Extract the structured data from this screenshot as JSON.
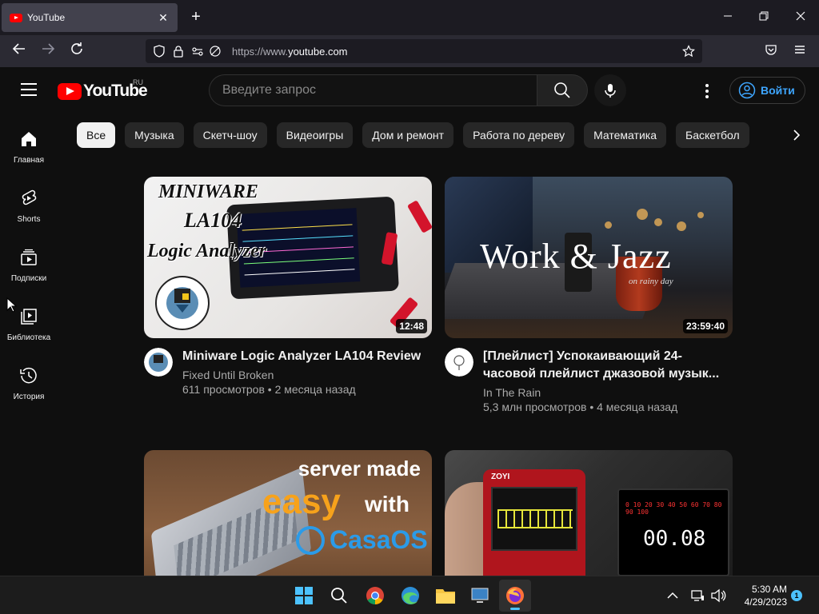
{
  "browser": {
    "tab_title": "YouTube",
    "tab_close": "✕",
    "new_tab": "+",
    "url_prefix": "https://www.",
    "url_domain": "youtube.com"
  },
  "youtube": {
    "logo_text": "YouTube",
    "region": "RU",
    "search_placeholder": "Введите запрос",
    "signin_label": "Войти",
    "sidebar": [
      {
        "label": "Главная",
        "icon": "home-icon"
      },
      {
        "label": "Shorts",
        "icon": "shorts-icon"
      },
      {
        "label": "Подписки",
        "icon": "subscriptions-icon"
      },
      {
        "label": "Библиотека",
        "icon": "library-icon"
      },
      {
        "label": "История",
        "icon": "history-icon"
      }
    ],
    "chips": [
      "Все",
      "Музыка",
      "Скетч-шоу",
      "Видеоигры",
      "Дом и ремонт",
      "Работа по дереву",
      "Математика",
      "Баскетбол"
    ],
    "videos": [
      {
        "title": "Miniware Logic Analyzer LA104 Review",
        "channel": "Fixed Until Broken",
        "stats": "611 просмотров • 2 месяца назад",
        "duration": "12:48",
        "thumb_line1": "MINIWARE",
        "thumb_line2": "LA104",
        "thumb_line3": "Logic Analyzer"
      },
      {
        "title": "[Плейлист] Успокаивающий 24-часовой плейлист джазовой музык...",
        "channel": "In The Rain",
        "stats": "5,3 млн просмотров • 4 месяца назад",
        "duration": "23:59:40",
        "thumb_line1": "Work & Jazz",
        "thumb_line2": "on rainy day"
      },
      {
        "thumb_line1": "server made",
        "thumb_line2": "easy",
        "thumb_line3": "with",
        "thumb_line4": "CasaOS"
      },
      {
        "thumb_brand": "ZOYI",
        "thumb_reading": "00.08"
      }
    ]
  },
  "taskbar": {
    "time": "5:30 AM",
    "date": "4/29/2023",
    "notifications": "1"
  }
}
